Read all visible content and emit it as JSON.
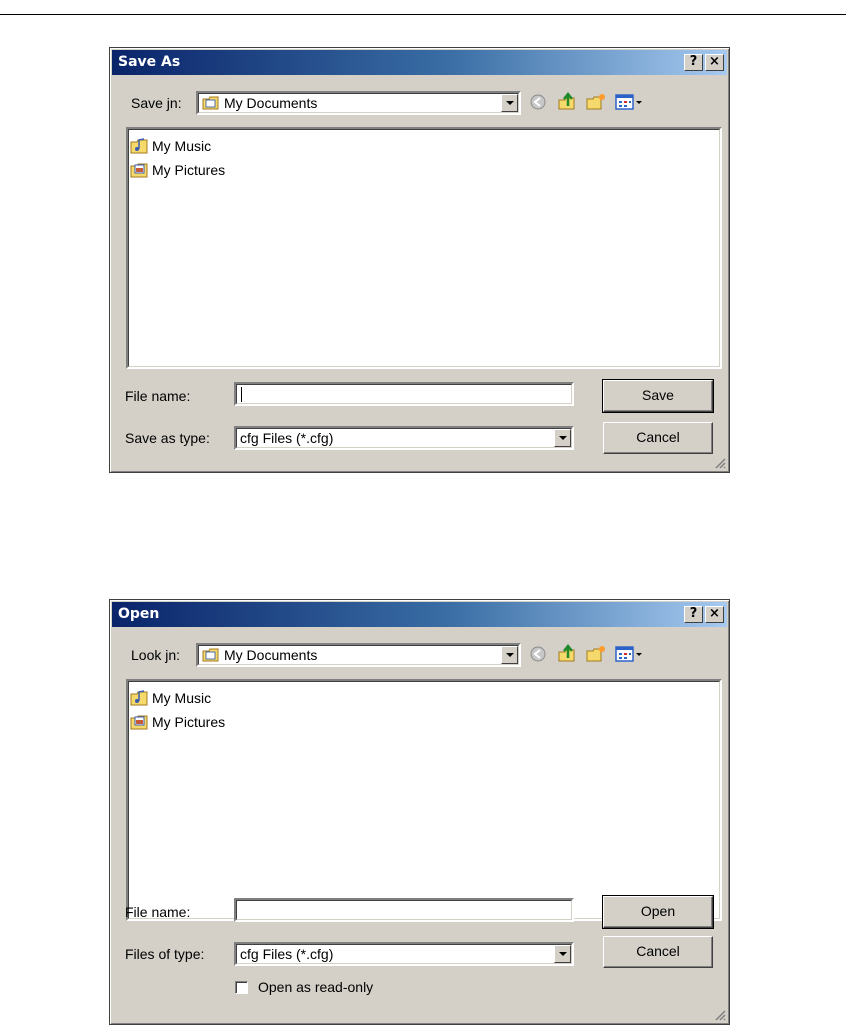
{
  "save_dialog": {
    "title": "Save As",
    "location_label": "Save jn:",
    "location_value": "My Documents",
    "files": [
      {
        "name": "My Music",
        "icon": "music-folder-icon"
      },
      {
        "name": "My Pictures",
        "icon": "pictures-folder-icon"
      }
    ],
    "filename_label": "File name:",
    "filename_value": "",
    "type_label": "Save as type:",
    "type_value": "cfg Files (*.cfg)",
    "primary_button": "Save",
    "cancel_button": "Cancel",
    "help_glyph": "?",
    "close_glyph": "×"
  },
  "open_dialog": {
    "title": "Open",
    "location_label": "Look jn:",
    "location_value": "My Documents",
    "files": [
      {
        "name": "My Music",
        "icon": "music-folder-icon"
      },
      {
        "name": "My Pictures",
        "icon": "pictures-folder-icon"
      }
    ],
    "filename_label": "File name:",
    "filename_value": "",
    "type_label": "Files of type:",
    "type_value": "cfg Files (*.cfg)",
    "primary_button": "Open",
    "cancel_button": "Cancel",
    "readonly_label": "Open as read-only",
    "readonly_checked": false,
    "help_glyph": "?",
    "close_glyph": "×"
  },
  "colors": {
    "titlebar_start": "#0a246a",
    "titlebar_end": "#a6caf0",
    "dialog_face": "#d4d0c8"
  },
  "toolbar_icons": [
    "back-icon",
    "up-folder-icon",
    "new-folder-icon",
    "views-menu-icon"
  ]
}
